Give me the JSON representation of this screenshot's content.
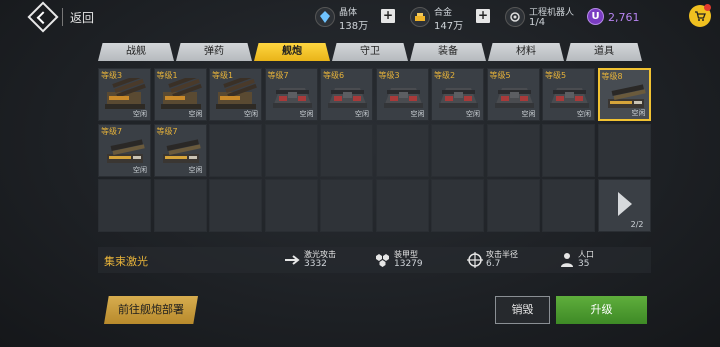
{
  "header": {
    "back_label": "返回",
    "resources": [
      {
        "name": "晶体",
        "value": "138万",
        "icon": "crystal-icon"
      },
      {
        "name": "合金",
        "value": "147万",
        "icon": "alloy-icon"
      },
      {
        "name": "工程机器人",
        "value": "1/4",
        "icon": "robot-icon"
      }
    ],
    "ucoin_symbol": "U",
    "ucoin_value": "2,761",
    "cart_icon": "cart-icon"
  },
  "tabs": [
    {
      "label": "战舰",
      "active": false
    },
    {
      "label": "弹药",
      "active": false
    },
    {
      "label": "舰炮",
      "active": true
    },
    {
      "label": "守卫",
      "active": false
    },
    {
      "label": "装备",
      "active": false
    },
    {
      "label": "材料",
      "active": false
    },
    {
      "label": "道具",
      "active": false
    }
  ],
  "grid": {
    "items": [
      {
        "level": "等级3",
        "status": "空闲",
        "kind": "triple"
      },
      {
        "level": "等级1",
        "status": "空闲",
        "kind": "triple"
      },
      {
        "level": "等级1",
        "status": "空闲",
        "kind": "triple"
      },
      {
        "level": "等级7",
        "status": "空闲",
        "kind": "dome"
      },
      {
        "level": "等级6",
        "status": "空闲",
        "kind": "dome"
      },
      {
        "level": "等级3",
        "status": "空闲",
        "kind": "dome"
      },
      {
        "level": "等级2",
        "status": "空闲",
        "kind": "dome"
      },
      {
        "level": "等级5",
        "status": "空闲",
        "kind": "dome"
      },
      {
        "level": "等级5",
        "status": "空闲",
        "kind": "dome"
      },
      {
        "level": "等级8",
        "status": "空闲",
        "kind": "laser",
        "selected": true
      },
      {
        "level": "等级7",
        "status": "空闲",
        "kind": "laser"
      },
      {
        "level": "等级7",
        "status": "空闲",
        "kind": "laser"
      }
    ],
    "page_indicator": "2/2"
  },
  "info": {
    "weapon_name": "集束激光",
    "stats": [
      {
        "name": "激光攻击",
        "value": "3332",
        "icon": "laser-attack-icon"
      },
      {
        "name": "装甲型",
        "value": "13279",
        "icon": "armor-type-icon"
      },
      {
        "name": "攻击半径",
        "value": "6.7",
        "icon": "crosshair-icon"
      },
      {
        "name": "人口",
        "value": "35",
        "icon": "population-icon"
      }
    ]
  },
  "buttons": {
    "deploy": "前往舰炮部署",
    "destroy": "销毁",
    "upgrade": "升级"
  },
  "colors": {
    "accent_gold": "#f1c232",
    "level_text": "#e7b33a",
    "upgrade_green": "#4f9d30",
    "ucoin_purple": "#7a3cc2"
  }
}
